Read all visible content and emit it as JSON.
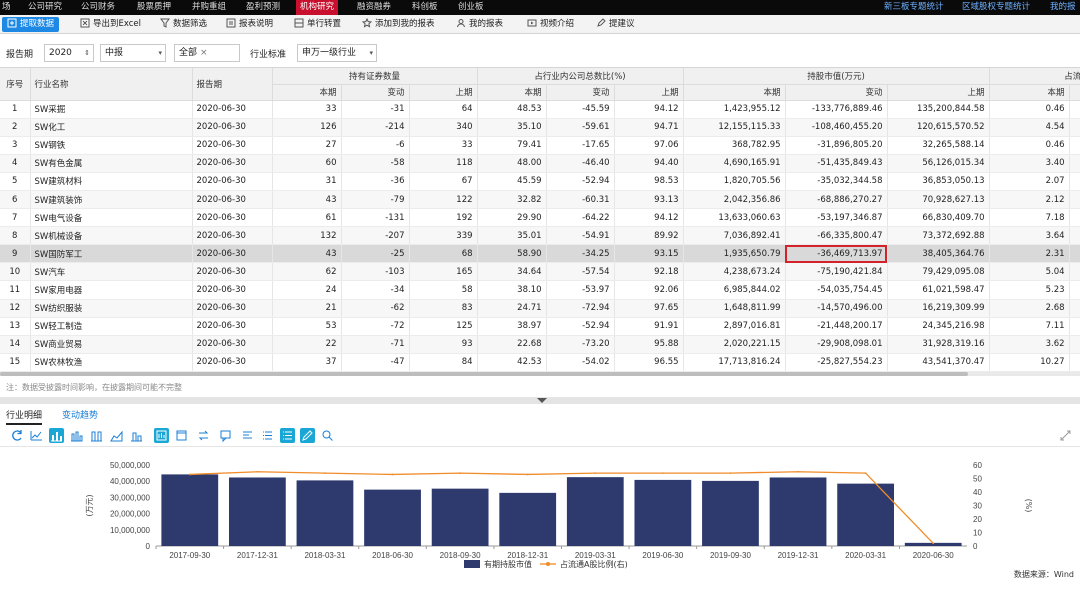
{
  "topnav": {
    "items": [
      "场",
      "公司研究",
      "公司财务",
      "股票质押",
      "并购重组",
      "盈利预测",
      "机构研究",
      "融资融券",
      "科创板",
      "创业板"
    ],
    "active_index": 6,
    "right_items": [
      "新三板专题统计",
      "区域股权专题统计",
      "我的报"
    ]
  },
  "toolbar": {
    "fetch": "提取数据",
    "export": "导出到Excel",
    "filter": "数据筛选",
    "report_desc": "报表说明",
    "transpose": "单行转置",
    "add_to_mine": "添加到我的报表",
    "my_reports": "我的报表",
    "video": "视频介绍",
    "suggest": "提建议"
  },
  "filters": {
    "period_label": "报告期",
    "year": "2020",
    "half": "中报",
    "scope": "全部",
    "std_label": "行业标准",
    "std_value": "申万一级行业"
  },
  "table": {
    "headers": {
      "seq": "序号",
      "name": "行业名称",
      "date": "报告期",
      "g1": "持有证券数量",
      "g2": "占行业内公司总数比(%)",
      "g3": "持股市值(万元)",
      "g4": "占流通A",
      "cur": "本期",
      "chg": "变动",
      "prev": "上期"
    },
    "rows": [
      [
        "1",
        "SW采掘",
        "2020-06-30",
        "33",
        "-31",
        "64",
        "48.53",
        "-45.59",
        "94.12",
        "1,423,955.12",
        "-133,776,889.46",
        "135,200,844.58",
        "0.46"
      ],
      [
        "2",
        "SW化工",
        "2020-06-30",
        "126",
        "-214",
        "340",
        "35.10",
        "-59.61",
        "94.71",
        "12,155,115.33",
        "-108,460,455.20",
        "120,615,570.52",
        "4.54"
      ],
      [
        "3",
        "SW钢铁",
        "2020-06-30",
        "27",
        "-6",
        "33",
        "79.41",
        "-17.65",
        "97.06",
        "368,782.95",
        "-31,896,805.20",
        "32,265,588.14",
        "0.46"
      ],
      [
        "4",
        "SW有色金属",
        "2020-06-30",
        "60",
        "-58",
        "118",
        "48.00",
        "-46.40",
        "94.40",
        "4,690,165.91",
        "-51,435,849.43",
        "56,126,015.34",
        "3.40"
      ],
      [
        "5",
        "SW建筑材料",
        "2020-06-30",
        "31",
        "-36",
        "67",
        "45.59",
        "-52.94",
        "98.53",
        "1,820,705.56",
        "-35,032,344.58",
        "36,853,050.13",
        "2.07"
      ],
      [
        "6",
        "SW建筑装饰",
        "2020-06-30",
        "43",
        "-79",
        "122",
        "32.82",
        "-60.31",
        "93.13",
        "2,042,356.86",
        "-68,886,270.27",
        "70,928,627.13",
        "2.12"
      ],
      [
        "7",
        "SW电气设备",
        "2020-06-30",
        "61",
        "-131",
        "192",
        "29.90",
        "-64.22",
        "94.12",
        "13,633,060.63",
        "-53,197,346.87",
        "66,830,409.70",
        "7.18"
      ],
      [
        "8",
        "SW机械设备",
        "2020-06-30",
        "132",
        "-207",
        "339",
        "35.01",
        "-54.91",
        "89.92",
        "7,036,892.41",
        "-66,335,800.47",
        "73,372,692.88",
        "3.64"
      ],
      [
        "9",
        "SW国防军工",
        "2020-06-30",
        "43",
        "-25",
        "68",
        "58.90",
        "-34.25",
        "93.15",
        "1,935,650.79",
        "-36,469,713.97",
        "38,405,364.76",
        "2.31"
      ],
      [
        "10",
        "SW汽车",
        "2020-06-30",
        "62",
        "-103",
        "165",
        "34.64",
        "-57.54",
        "92.18",
        "4,238,673.24",
        "-75,190,421.84",
        "79,429,095.08",
        "5.04"
      ],
      [
        "11",
        "SW家用电器",
        "2020-06-30",
        "24",
        "-34",
        "58",
        "38.10",
        "-53.97",
        "92.06",
        "6,985,844.02",
        "-54,035,754.45",
        "61,021,598.47",
        "5.23"
      ],
      [
        "12",
        "SW纺织服装",
        "2020-06-30",
        "21",
        "-62",
        "83",
        "24.71",
        "-72.94",
        "97.65",
        "1,648,811.99",
        "-14,570,496.00",
        "16,219,309.99",
        "2.68"
      ],
      [
        "13",
        "SW轻工制造",
        "2020-06-30",
        "53",
        "-72",
        "125",
        "38.97",
        "-52.94",
        "91.91",
        "2,897,016.81",
        "-21,448,200.17",
        "24,345,216.98",
        "7.11"
      ],
      [
        "14",
        "SW商业贸易",
        "2020-06-30",
        "22",
        "-71",
        "93",
        "22.68",
        "-73.20",
        "95.88",
        "2,020,221.15",
        "-29,908,098.01",
        "31,928,319.16",
        "3.62"
      ],
      [
        "15",
        "SW农林牧渔",
        "2020-06-30",
        "37",
        "-47",
        "84",
        "42.53",
        "-54.02",
        "96.55",
        "17,713,816.24",
        "-25,827,554.23",
        "43,541,370.47",
        "10.27"
      ]
    ],
    "selected_row": 8
  },
  "note": "注：数据受披露时间影响，在披露期间可能不完整",
  "detail_tabs": [
    "行业明细",
    "变动趋势"
  ],
  "chart_data": {
    "type": "bar",
    "categories": [
      "2017-09-30",
      "2017-12-31",
      "2018-03-31",
      "2018-06-30",
      "2018-09-30",
      "2018-12-31",
      "2019-03-31",
      "2019-06-30",
      "2019-09-30",
      "2019-12-31",
      "2020-03-31",
      "2020-06-30"
    ],
    "series": [
      {
        "name": "有期持股市值",
        "type": "bar",
        "axis": "left",
        "values": [
          44200000,
          42300000,
          40500000,
          34800000,
          35400000,
          32800000,
          42500000,
          40800000,
          40200000,
          42300000,
          38500000,
          1940000
        ]
      },
      {
        "name": "占流通A股比例(右)",
        "type": "line",
        "axis": "right",
        "values": [
          53,
          55,
          54,
          53,
          54,
          53,
          54,
          54,
          54,
          55,
          54,
          2
        ]
      }
    ],
    "ylabel_left": "(万元)",
    "ylabel_right": "(%)",
    "ylim_left": [
      0,
      50000000
    ],
    "ylim_right": [
      0,
      60
    ],
    "yticks_left": [
      "0",
      "10,000,000",
      "20,000,000",
      "30,000,000",
      "40,000,000",
      "50,000,000"
    ],
    "yticks_right": [
      "0",
      "10",
      "20",
      "30",
      "40",
      "50",
      "60"
    ],
    "legend_position": "bottom",
    "colors": {
      "bar": "#2e3a6e",
      "line": "#f08c2a"
    }
  },
  "source": "数据来源：Wind"
}
